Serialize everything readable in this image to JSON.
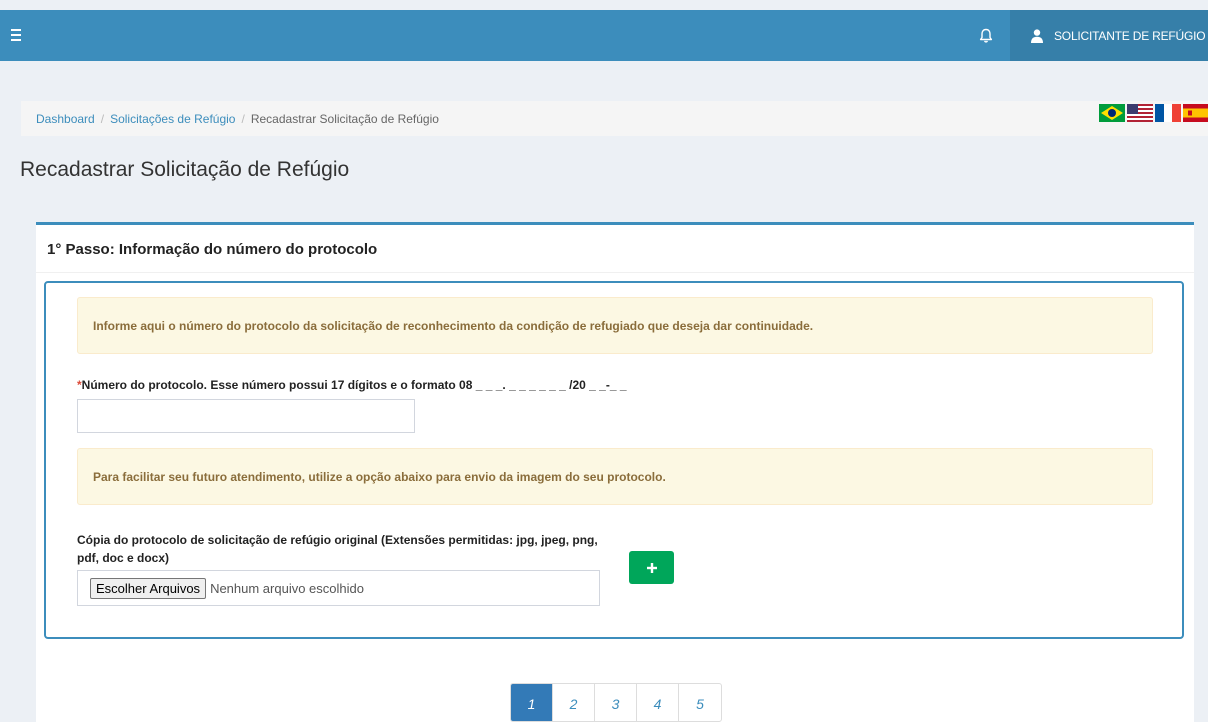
{
  "header": {
    "menu_icon": "hamburger-icon",
    "notification_icon": "bell-icon",
    "user_icon": "user-icon",
    "user_name": "SOLICITANTE DE REFÚGIO"
  },
  "breadcrumb": {
    "items": [
      "Dashboard",
      "Solicitações de Refúgio"
    ],
    "separator": "/",
    "current": "Recadastrar Solicitação de Refúgio"
  },
  "languages": [
    "brazil-flag-icon",
    "usa-flag-icon",
    "france-flag-icon",
    "spain-flag-icon"
  ],
  "page_title": "Recadastrar Solicitação de Refúgio",
  "step": {
    "title": "1° Passo: Informação do número do protocolo",
    "info_alert": "Informe aqui o número do protocolo da solicitação de reconhecimento da condição de refugiado que deseja dar continuidade.",
    "protocol_required_mark": "*",
    "protocol_label": "Número do protocolo. Esse número possui 17 dígitos e o formato 08 _ _ _. _ _ _ _ _ _ /20 _ _-_ _",
    "protocol_value": "",
    "upload_alert": "Para facilitar seu futuro atendimento, utilize a opção abaixo para envio da imagem do seu protocolo.",
    "upload_label": "Cópia do protocolo de solicitação de refúgio original (Extensões permitidas: jpg, jpeg, png, pdf, doc e docx)",
    "file_button": "Escolher Arquivos",
    "file_status": "Nenhum arquivo escolhido",
    "add_icon": "plus-icon"
  },
  "pagination": {
    "pages": [
      "1",
      "2",
      "3",
      "4",
      "5"
    ],
    "active": "1"
  },
  "colors": {
    "header": "#3c8dbc",
    "user_block": "#367fa9",
    "alert_bg": "#fcf8e3",
    "alert_text": "#8a6d3b",
    "success": "#00a65a",
    "required": "#dd4b39"
  }
}
